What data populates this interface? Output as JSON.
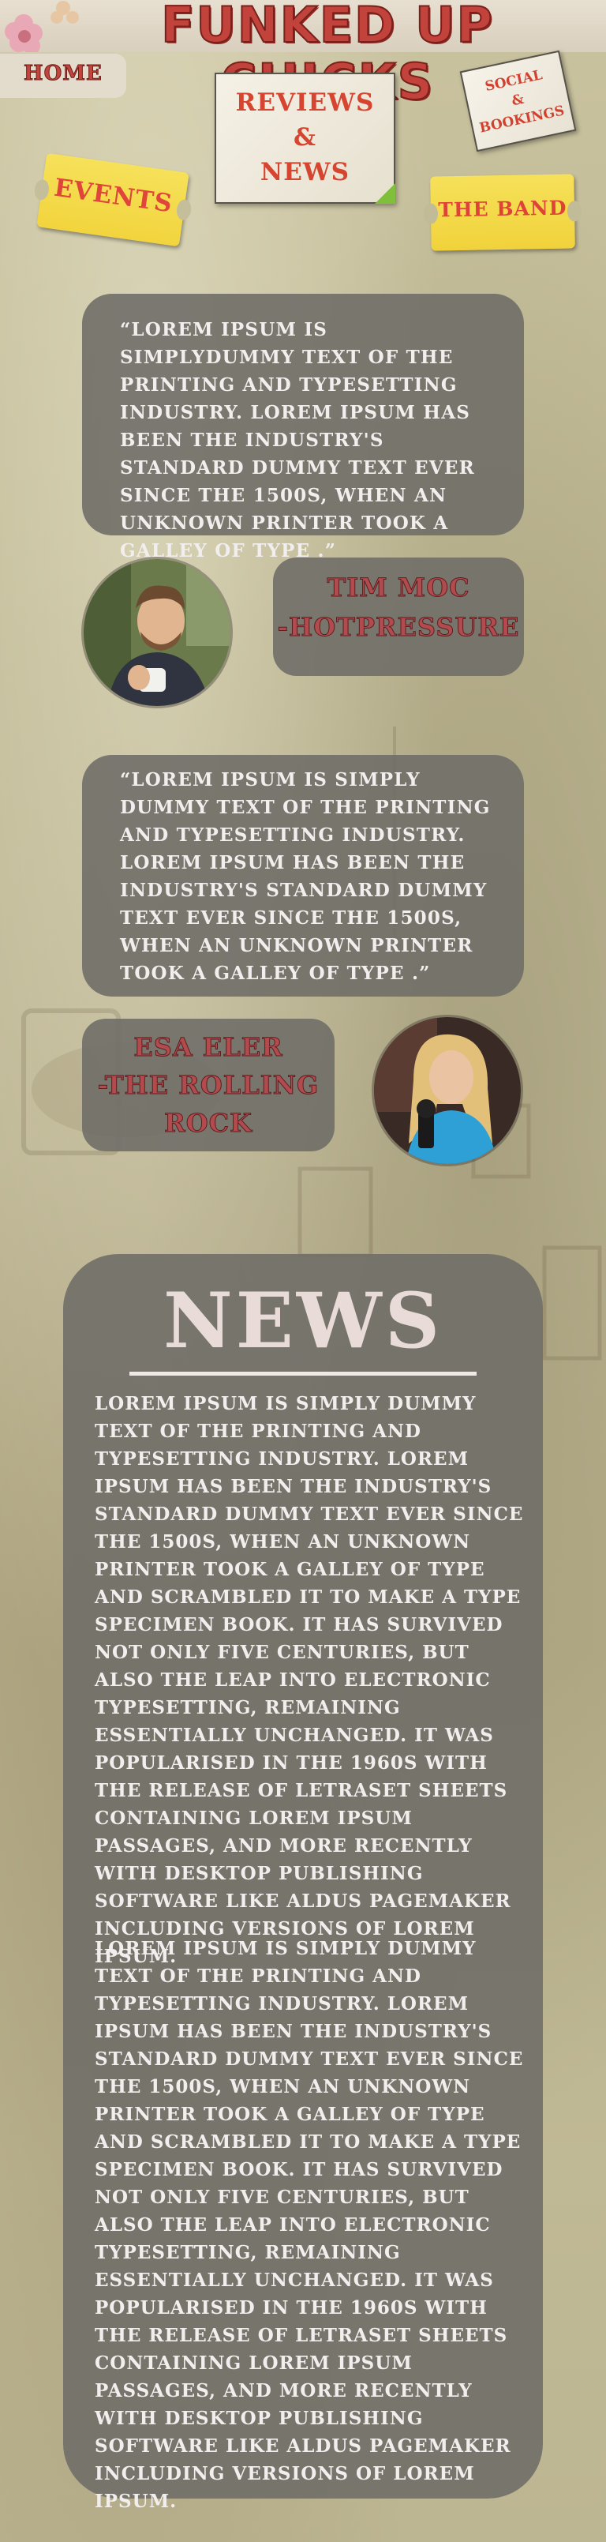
{
  "header": {
    "site_title": "FUNKED UP CHICKS",
    "home_label": "HOME"
  },
  "nav": {
    "reviews_news": [
      "REVIEWS",
      "&",
      "NEWS"
    ],
    "social_bookings": [
      "SOCIAL",
      "&",
      "BOOKINGS"
    ],
    "events": "EVENTS",
    "the_band": "THE BAND"
  },
  "reviews": [
    {
      "quote": "“LOREM IPSUM IS SIMPLYDUMMY TEXT OF THE PRINTING AND TYPESETTING INDUSTRY. LOREM IPSUM HAS BEEN THE INDUSTRY'S STANDARD DUMMY TEXT EVER SINCE THE 1500S, WHEN AN UNKNOWN PRINTER TOOK A GALLEY OF TYPE .”",
      "name_line1": "TIM MOC",
      "name_line2": "-HOTPRESSURE"
    },
    {
      "quote": "“LOREM IPSUM IS SIMPLY DUMMY TEXT OF THE PRINTING AND TYPESETTING INDUSTRY. LOREM IPSUM HAS BEEN THE INDUSTRY'S STANDARD DUMMY TEXT EVER SINCE THE 1500S, WHEN AN UNKNOWN PRINTER TOOK A GALLEY OF TYPE .”",
      "name_line1": "ESA ELER",
      "name_line2": "-THE ROLLING",
      "name_line3": "ROCK"
    }
  ],
  "news": {
    "title": "NEWS",
    "paragraphs": [
      "LOREM IPSUM IS SIMPLY DUMMY TEXT OF THE PRINTING AND TYPESETTING INDUSTRY. LOREM IPSUM HAS BEEN THE INDUSTRY'S STANDARD DUMMY TEXT EVER SINCE THE 1500S, WHEN AN UNKNOWN PRINTER TOOK A GALLEY OF TYPE AND SCRAMBLED IT TO MAKE A TYPE SPECIMEN BOOK. IT HAS SURVIVED NOT ONLY FIVE CENTURIES, BUT ALSO THE LEAP INTO ELECTRONIC TYPESETTING, REMAINING ESSENTIALLY UNCHANGED. IT WAS POPULARISED IN THE 1960S WITH THE RELEASE OF LETRASET SHEETS CONTAINING LOREM IPSUM PASSAGES, AND MORE RECENTLY WITH DESKTOP PUBLISHING SOFTWARE LIKE ALDUS PAGEMAKER INCLUDING VERSIONS OF LOREM IPSUM.",
      "LOREM IPSUM IS SIMPLY DUMMY TEXT OF THE PRINTING AND TYPESETTING INDUSTRY. LOREM IPSUM HAS BEEN THE INDUSTRY'S STANDARD DUMMY TEXT EVER SINCE THE 1500S, WHEN AN UNKNOWN PRINTER TOOK A GALLEY OF TYPE AND SCRAMBLED IT TO MAKE A TYPE SPECIMEN BOOK. IT HAS SURVIVED NOT ONLY FIVE CENTURIES, BUT ALSO THE LEAP INTO ELECTRONIC TYPESETTING, REMAINING ESSENTIALLY UNCHANGED. IT WAS POPULARISED IN THE 1960S WITH THE RELEASE OF LETRASET SHEETS CONTAINING LOREM IPSUM PASSAGES, AND MORE RECENTLY WITH DESKTOP PUBLISHING SOFTWARE LIKE ALDUS PAGEMAKER INCLUDING VERSIONS OF LOREM IPSUM."
    ]
  },
  "colors": {
    "title_red": "#c2433b",
    "panel_gray": "#706e68",
    "ticket_yellow": "#f4dc4b",
    "name_red": "#b24b4e"
  }
}
